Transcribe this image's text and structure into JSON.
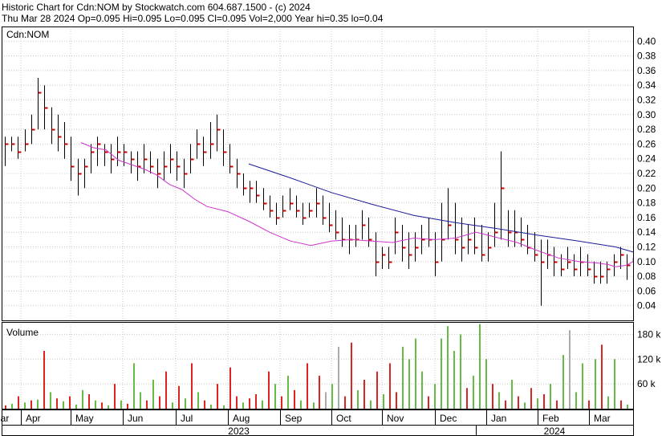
{
  "header": {
    "line1": "Historic Chart for Cdn:NOM by Stockwatch.com 604.687.1500 - (c) 2024",
    "line2": "Thu Mar 28 2024  Op=0.095  Hi=0.095  Lo=0.095  Cl=0.095  Vol=2,000  Year hi=0.35  lo=0.04"
  },
  "colors": {
    "frame": "#000000",
    "grid": "#c8c8c8",
    "price": "#000000",
    "close_tick": "#cc0000",
    "ma_short": "#cc33cc",
    "ma_long": "#1a1a99",
    "vol_up": "#66bb44",
    "vol_down": "#dd2222",
    "vol_neutral": "#aaaaaa"
  },
  "chart_data": {
    "type": "ohlc",
    "symbol_label": "Cdn:NOM",
    "volume_label": "Volume",
    "y_ticks": [
      "0.40",
      "0.38",
      "0.36",
      "0.34",
      "0.32",
      "0.30",
      "0.28",
      "0.26",
      "0.24",
      "0.22",
      "0.20",
      "0.18",
      "0.16",
      "0.14",
      "0.12",
      "0.10",
      "0.08",
      "0.06",
      "0.04"
    ],
    "ylim": [
      0.02,
      0.42
    ],
    "volume_ticks": [
      "180 k",
      "120 k",
      "60 k"
    ],
    "volume_lim": [
      0,
      210000
    ],
    "months": [
      "ar",
      "Apr",
      "May",
      "Jun",
      "Jul",
      "Aug",
      "Sep",
      "Oct",
      "Nov",
      "Dec",
      "Jan",
      "Feb",
      "Mar"
    ],
    "years": [
      "2023",
      "2024"
    ],
    "bars": [
      {
        "h": 0.27,
        "l": 0.23,
        "c": 0.26
      },
      {
        "h": 0.27,
        "l": 0.25,
        "c": 0.26
      },
      {
        "h": 0.27,
        "l": 0.24,
        "c": 0.25
      },
      {
        "h": 0.28,
        "l": 0.25,
        "c": 0.26
      },
      {
        "h": 0.3,
        "l": 0.26,
        "c": 0.28
      },
      {
        "h": 0.35,
        "l": 0.28,
        "c": 0.33
      },
      {
        "h": 0.34,
        "l": 0.28,
        "c": 0.31
      },
      {
        "h": 0.31,
        "l": 0.26,
        "c": 0.28
      },
      {
        "h": 0.3,
        "l": 0.25,
        "c": 0.27
      },
      {
        "h": 0.29,
        "l": 0.24,
        "c": 0.26
      },
      {
        "h": 0.27,
        "l": 0.21,
        "c": 0.23
      },
      {
        "h": 0.24,
        "l": 0.19,
        "c": 0.22
      },
      {
        "h": 0.24,
        "l": 0.2,
        "c": 0.23
      },
      {
        "h": 0.26,
        "l": 0.22,
        "c": 0.25
      },
      {
        "h": 0.27,
        "l": 0.23,
        "c": 0.26
      },
      {
        "h": 0.26,
        "l": 0.23,
        "c": 0.25
      },
      {
        "h": 0.26,
        "l": 0.22,
        "c": 0.24
      },
      {
        "h": 0.27,
        "l": 0.23,
        "c": 0.25
      },
      {
        "h": 0.26,
        "l": 0.23,
        "c": 0.25
      },
      {
        "h": 0.25,
        "l": 0.22,
        "c": 0.24
      },
      {
        "h": 0.25,
        "l": 0.21,
        "c": 0.23
      },
      {
        "h": 0.26,
        "l": 0.22,
        "c": 0.24
      },
      {
        "h": 0.25,
        "l": 0.22,
        "c": 0.23
      },
      {
        "h": 0.24,
        "l": 0.2,
        "c": 0.22
      },
      {
        "h": 0.25,
        "l": 0.21,
        "c": 0.23
      },
      {
        "h": 0.26,
        "l": 0.22,
        "c": 0.24
      },
      {
        "h": 0.25,
        "l": 0.21,
        "c": 0.23
      },
      {
        "h": 0.24,
        "l": 0.2,
        "c": 0.22
      },
      {
        "h": 0.26,
        "l": 0.22,
        "c": 0.24
      },
      {
        "h": 0.28,
        "l": 0.24,
        "c": 0.26
      },
      {
        "h": 0.27,
        "l": 0.23,
        "c": 0.25
      },
      {
        "h": 0.29,
        "l": 0.24,
        "c": 0.26
      },
      {
        "h": 0.3,
        "l": 0.25,
        "c": 0.28
      },
      {
        "h": 0.28,
        "l": 0.23,
        "c": 0.25
      },
      {
        "h": 0.26,
        "l": 0.22,
        "c": 0.23
      },
      {
        "h": 0.24,
        "l": 0.2,
        "c": 0.22
      },
      {
        "h": 0.22,
        "l": 0.19,
        "c": 0.2
      },
      {
        "h": 0.21,
        "l": 0.18,
        "c": 0.2
      },
      {
        "h": 0.21,
        "l": 0.18,
        "c": 0.19
      },
      {
        "h": 0.2,
        "l": 0.17,
        "c": 0.18
      },
      {
        "h": 0.19,
        "l": 0.16,
        "c": 0.17
      },
      {
        "h": 0.18,
        "l": 0.15,
        "c": 0.16
      },
      {
        "h": 0.19,
        "l": 0.16,
        "c": 0.17
      },
      {
        "h": 0.2,
        "l": 0.17,
        "c": 0.18
      },
      {
        "h": 0.19,
        "l": 0.16,
        "c": 0.17
      },
      {
        "h": 0.18,
        "l": 0.15,
        "c": 0.16
      },
      {
        "h": 0.18,
        "l": 0.16,
        "c": 0.17
      },
      {
        "h": 0.2,
        "l": 0.16,
        "c": 0.18
      },
      {
        "h": 0.19,
        "l": 0.15,
        "c": 0.16
      },
      {
        "h": 0.18,
        "l": 0.14,
        "c": 0.15
      },
      {
        "h": 0.17,
        "l": 0.13,
        "c": 0.14
      },
      {
        "h": 0.16,
        "l": 0.12,
        "c": 0.13
      },
      {
        "h": 0.15,
        "l": 0.11,
        "c": 0.13
      },
      {
        "h": 0.15,
        "l": 0.12,
        "c": 0.13
      },
      {
        "h": 0.17,
        "l": 0.13,
        "c": 0.15
      },
      {
        "h": 0.16,
        "l": 0.12,
        "c": 0.13
      },
      {
        "h": 0.14,
        "l": 0.08,
        "c": 0.1
      },
      {
        "h": 0.12,
        "l": 0.09,
        "c": 0.11
      },
      {
        "h": 0.12,
        "l": 0.09,
        "c": 0.1
      },
      {
        "h": 0.16,
        "l": 0.11,
        "c": 0.14
      },
      {
        "h": 0.15,
        "l": 0.1,
        "c": 0.12
      },
      {
        "h": 0.14,
        "l": 0.09,
        "c": 0.11
      },
      {
        "h": 0.14,
        "l": 0.1,
        "c": 0.12
      },
      {
        "h": 0.15,
        "l": 0.11,
        "c": 0.13
      },
      {
        "h": 0.16,
        "l": 0.12,
        "c": 0.13
      },
      {
        "h": 0.14,
        "l": 0.08,
        "c": 0.1
      },
      {
        "h": 0.18,
        "l": 0.1,
        "c": 0.13
      },
      {
        "h": 0.2,
        "l": 0.13,
        "c": 0.15
      },
      {
        "h": 0.18,
        "l": 0.11,
        "c": 0.13
      },
      {
        "h": 0.16,
        "l": 0.1,
        "c": 0.12
      },
      {
        "h": 0.15,
        "l": 0.11,
        "c": 0.13
      },
      {
        "h": 0.16,
        "l": 0.11,
        "c": 0.12
      },
      {
        "h": 0.15,
        "l": 0.1,
        "c": 0.11
      },
      {
        "h": 0.14,
        "l": 0.1,
        "c": 0.12
      },
      {
        "h": 0.18,
        "l": 0.12,
        "c": 0.14
      },
      {
        "h": 0.25,
        "l": 0.13,
        "c": 0.2
      },
      {
        "h": 0.17,
        "l": 0.12,
        "c": 0.14
      },
      {
        "h": 0.17,
        "l": 0.12,
        "c": 0.14
      },
      {
        "h": 0.16,
        "l": 0.12,
        "c": 0.13
      },
      {
        "h": 0.15,
        "l": 0.11,
        "c": 0.12
      },
      {
        "h": 0.14,
        "l": 0.1,
        "c": 0.11
      },
      {
        "h": 0.13,
        "l": 0.04,
        "c": 0.1
      },
      {
        "h": 0.13,
        "l": 0.09,
        "c": 0.11
      },
      {
        "h": 0.12,
        "l": 0.08,
        "c": 0.1
      },
      {
        "h": 0.11,
        "l": 0.08,
        "c": 0.09
      },
      {
        "h": 0.12,
        "l": 0.09,
        "c": 0.1
      },
      {
        "h": 0.11,
        "l": 0.08,
        "c": 0.09
      },
      {
        "h": 0.12,
        "l": 0.08,
        "c": 0.1
      },
      {
        "h": 0.11,
        "l": 0.08,
        "c": 0.09
      },
      {
        "h": 0.1,
        "l": 0.07,
        "c": 0.08
      },
      {
        "h": 0.1,
        "l": 0.07,
        "c": 0.08
      },
      {
        "h": 0.1,
        "l": 0.07,
        "c": 0.09
      },
      {
        "h": 0.11,
        "l": 0.08,
        "c": 0.1
      },
      {
        "h": 0.12,
        "l": 0.09,
        "c": 0.11
      },
      {
        "h": 0.11,
        "l": 0.075,
        "c": 0.095
      }
    ],
    "ma_short": [
      [
        0.3,
        0.262
      ],
      [
        0.36,
        0.255
      ],
      [
        0.42,
        0.252
      ],
      [
        0.48,
        0.238
      ],
      [
        0.54,
        0.232
      ],
      [
        0.6,
        0.226
      ],
      [
        0.66,
        0.218
      ],
      [
        0.72,
        0.205
      ],
      [
        0.78,
        0.198
      ],
      [
        0.84,
        0.185
      ],
      [
        0.9,
        0.175
      ],
      [
        1.0,
        0.168
      ],
      [
        1.1,
        0.155
      ],
      [
        1.2,
        0.14
      ],
      [
        1.3,
        0.128
      ],
      [
        1.4,
        0.122
      ],
      [
        1.5,
        0.128
      ],
      [
        1.6,
        0.13
      ],
      [
        1.7,
        0.128
      ],
      [
        1.8,
        0.126
      ],
      [
        1.9,
        0.132
      ],
      [
        2.0,
        0.13
      ],
      [
        2.1,
        0.132
      ],
      [
        2.2,
        0.14
      ],
      [
        2.3,
        0.133
      ],
      [
        2.4,
        0.126
      ],
      [
        2.5,
        0.115
      ],
      [
        2.6,
        0.105
      ],
      [
        2.7,
        0.1
      ],
      [
        2.8,
        0.098
      ],
      [
        2.86,
        0.096
      ],
      [
        2.9,
        0.093
      ],
      [
        2.96,
        0.095
      ],
      [
        3.02,
        0.1
      ],
      [
        3.08,
        0.105
      ]
    ],
    "ma_long": [
      [
        1.1,
        0.233
      ],
      [
        1.3,
        0.214
      ],
      [
        1.5,
        0.194
      ],
      [
        1.7,
        0.178
      ],
      [
        1.9,
        0.163
      ],
      [
        2.1,
        0.153
      ],
      [
        2.3,
        0.145
      ],
      [
        2.5,
        0.136
      ],
      [
        2.7,
        0.128
      ],
      [
        2.9,
        0.12
      ],
      [
        3.08,
        0.113
      ]
    ],
    "volume": [
      {
        "v": 8000,
        "t": "down"
      },
      {
        "v": 12000,
        "t": "up"
      },
      {
        "v": 30000,
        "t": "down"
      },
      {
        "v": 15000,
        "t": "up"
      },
      {
        "v": 20000,
        "t": "down"
      },
      {
        "v": 22000,
        "t": "up"
      },
      {
        "v": 140000,
        "t": "down"
      },
      {
        "v": 40000,
        "t": "up"
      },
      {
        "v": 25000,
        "t": "down"
      },
      {
        "v": 18000,
        "t": "up"
      },
      {
        "v": 30000,
        "t": "down"
      },
      {
        "v": 10000,
        "t": "up"
      },
      {
        "v": 45000,
        "t": "up"
      },
      {
        "v": 35000,
        "t": "down"
      },
      {
        "v": 20000,
        "t": "up"
      },
      {
        "v": 15000,
        "t": "down"
      },
      {
        "v": 8000,
        "t": "up"
      },
      {
        "v": 60000,
        "t": "down"
      },
      {
        "v": 20000,
        "t": "up"
      },
      {
        "v": 12000,
        "t": "down"
      },
      {
        "v": 110000,
        "t": "up"
      },
      {
        "v": 40000,
        "t": "up"
      },
      {
        "v": 20000,
        "t": "down"
      },
      {
        "v": 70000,
        "t": "up"
      },
      {
        "v": 30000,
        "t": "down"
      },
      {
        "v": 90000,
        "t": "down"
      },
      {
        "v": 15000,
        "t": "up"
      },
      {
        "v": 55000,
        "t": "down"
      },
      {
        "v": 25000,
        "t": "up"
      },
      {
        "v": 110000,
        "t": "down"
      },
      {
        "v": 40000,
        "t": "up"
      },
      {
        "v": 20000,
        "t": "down"
      },
      {
        "v": 10000,
        "t": "up"
      },
      {
        "v": 60000,
        "t": "down"
      },
      {
        "v": 8000,
        "t": "up"
      },
      {
        "v": 100000,
        "t": "down"
      },
      {
        "v": 30000,
        "t": "down"
      },
      {
        "v": 15000,
        "t": "up"
      },
      {
        "v": 25000,
        "t": "down"
      },
      {
        "v": 35000,
        "t": "down"
      },
      {
        "v": 20000,
        "t": "up"
      },
      {
        "v": 90000,
        "t": "down"
      },
      {
        "v": 60000,
        "t": "up"
      },
      {
        "v": 30000,
        "t": "down"
      },
      {
        "v": 80000,
        "t": "up"
      },
      {
        "v": 45000,
        "t": "down"
      },
      {
        "v": 20000,
        "t": "up"
      },
      {
        "v": 110000,
        "t": "down"
      },
      {
        "v": 15000,
        "t": "up"
      },
      {
        "v": 80000,
        "t": "down"
      },
      {
        "v": 40000,
        "t": "neutral"
      },
      {
        "v": 60000,
        "t": "up"
      },
      {
        "v": 150000,
        "t": "neutral"
      },
      {
        "v": 30000,
        "t": "down"
      },
      {
        "v": 160000,
        "t": "down"
      },
      {
        "v": 45000,
        "t": "up"
      },
      {
        "v": 70000,
        "t": "down"
      },
      {
        "v": 20000,
        "t": "up"
      },
      {
        "v": 90000,
        "t": "down"
      },
      {
        "v": 35000,
        "t": "up"
      },
      {
        "v": 110000,
        "t": "down"
      },
      {
        "v": 40000,
        "t": "down"
      },
      {
        "v": 150000,
        "t": "up"
      },
      {
        "v": 120000,
        "t": "up"
      },
      {
        "v": 170000,
        "t": "up"
      },
      {
        "v": 90000,
        "t": "up"
      },
      {
        "v": 30000,
        "t": "down"
      },
      {
        "v": 60000,
        "t": "up"
      },
      {
        "v": 170000,
        "t": "up"
      },
      {
        "v": 200000,
        "t": "up"
      },
      {
        "v": 140000,
        "t": "up"
      },
      {
        "v": 180000,
        "t": "up"
      },
      {
        "v": 50000,
        "t": "down"
      },
      {
        "v": 80000,
        "t": "up"
      },
      {
        "v": 205000,
        "t": "up"
      },
      {
        "v": 120000,
        "t": "up"
      },
      {
        "v": 60000,
        "t": "down"
      },
      {
        "v": 40000,
        "t": "up"
      },
      {
        "v": 20000,
        "t": "down"
      },
      {
        "v": 70000,
        "t": "up"
      },
      {
        "v": 30000,
        "t": "down"
      },
      {
        "v": 15000,
        "t": "up"
      },
      {
        "v": 50000,
        "t": "down"
      },
      {
        "v": 25000,
        "t": "up"
      },
      {
        "v": 35000,
        "t": "down"
      },
      {
        "v": 60000,
        "t": "up"
      },
      {
        "v": 20000,
        "t": "down"
      },
      {
        "v": 130000,
        "t": "up"
      },
      {
        "v": 190000,
        "t": "neutral"
      },
      {
        "v": 40000,
        "t": "up"
      },
      {
        "v": 110000,
        "t": "up"
      },
      {
        "v": 20000,
        "t": "down"
      },
      {
        "v": 120000,
        "t": "up"
      },
      {
        "v": 155000,
        "t": "down"
      },
      {
        "v": 30000,
        "t": "up"
      },
      {
        "v": 120000,
        "t": "up"
      },
      {
        "v": 20000,
        "t": "down"
      },
      {
        "v": 10000,
        "t": "up"
      }
    ]
  }
}
